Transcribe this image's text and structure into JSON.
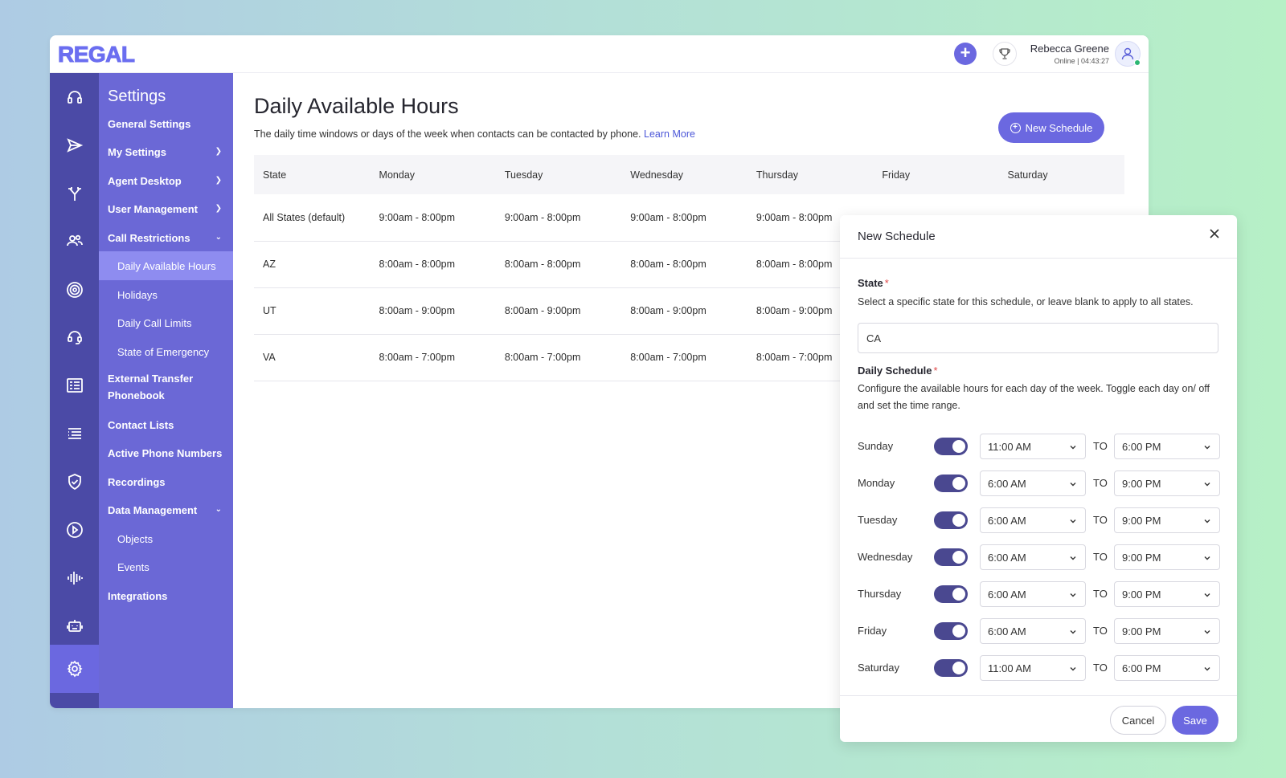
{
  "brand": "REGAL",
  "header": {
    "user_name": "Rebecca Greene",
    "user_status": "Online | 04:43:27"
  },
  "iconbar": {
    "icons": [
      "headset-icon",
      "send-icon",
      "branch-icon",
      "people-icon",
      "target-icon",
      "support-headset-icon",
      "form-list-icon",
      "list-icon",
      "shield-check-icon",
      "play-circle-icon",
      "audio-wave-icon",
      "robot-icon",
      "gear-icon"
    ]
  },
  "nav": {
    "title": "Settings",
    "items": [
      {
        "label": "General Settings"
      },
      {
        "label": "My Settings"
      },
      {
        "label": "Agent Desktop"
      },
      {
        "label": "User Management"
      },
      {
        "label": "Call Restrictions"
      },
      {
        "label": "Daily Available Hours"
      },
      {
        "label": "Holidays"
      },
      {
        "label": "Daily Call Limits"
      },
      {
        "label": "State of Emergency"
      },
      {
        "label": "External Transfer Phonebook"
      },
      {
        "label": "Contact Lists"
      },
      {
        "label": "Active Phone Numbers"
      },
      {
        "label": "Recordings"
      },
      {
        "label": "Data Management"
      },
      {
        "label": "Objects"
      },
      {
        "label": "Events"
      },
      {
        "label": "Integrations"
      }
    ]
  },
  "page": {
    "title": "Daily Available Hours",
    "description": "The daily time windows or days of the week when contacts can be contacted by phone.",
    "learn_more": "Learn More",
    "new_schedule_label": "New Schedule"
  },
  "table": {
    "headers": [
      "State",
      "Monday",
      "Tuesday",
      "Wednesday",
      "Thursday",
      "Friday",
      "Saturday"
    ],
    "rows": [
      [
        "All States (default)",
        "9:00am - 8:00pm",
        "9:00am - 8:00pm",
        "9:00am - 8:00pm",
        "9:00am - 8:00pm"
      ],
      [
        "AZ",
        "8:00am - 8:00pm",
        "8:00am - 8:00pm",
        "8:00am - 8:00pm",
        "8:00am - 8:00pm"
      ],
      [
        "UT",
        "8:00am - 9:00pm",
        "8:00am - 9:00pm",
        "8:00am - 9:00pm",
        "8:00am - 9:00pm"
      ],
      [
        "VA",
        "8:00am - 7:00pm",
        "8:00am - 7:00pm",
        "8:00am - 7:00pm",
        "8:00am - 7:00pm"
      ]
    ]
  },
  "modal": {
    "title": "New Schedule",
    "state_label": "State",
    "state_help": "Select a specific state for this schedule, or leave blank to apply to all states.",
    "state_value": "CA",
    "schedule_label": "Daily Schedule",
    "schedule_help": "Configure the available hours for each day of the week. Toggle each day on/ off and set the time range.",
    "required_mark": "*",
    "to_label": "TO",
    "days": [
      {
        "name": "Sunday",
        "enabled": true,
        "from": "11:00 AM",
        "to": "6:00 PM"
      },
      {
        "name": "Monday",
        "enabled": true,
        "from": "6:00 AM",
        "to": "9:00 PM"
      },
      {
        "name": "Tuesday",
        "enabled": true,
        "from": "6:00 AM",
        "to": "9:00 PM"
      },
      {
        "name": "Wednesday",
        "enabled": true,
        "from": "6:00 AM",
        "to": "9:00 PM"
      },
      {
        "name": "Thursday",
        "enabled": true,
        "from": "6:00 AM",
        "to": "9:00 PM"
      },
      {
        "name": "Friday",
        "enabled": true,
        "from": "6:00 AM",
        "to": "9:00 PM"
      },
      {
        "name": "Saturday",
        "enabled": true,
        "from": "11:00 AM",
        "to": "6:00 PM"
      }
    ],
    "cancel_label": "Cancel",
    "save_label": "Save"
  },
  "colors": {
    "accent": "#6b68e0",
    "iconbar": "#4b4aa6",
    "navpanel": "#6b68d6",
    "nav_active": "#8e8cf0",
    "toggle_on": "#4a4890",
    "link": "#4c57d8",
    "required": "#e04848"
  }
}
